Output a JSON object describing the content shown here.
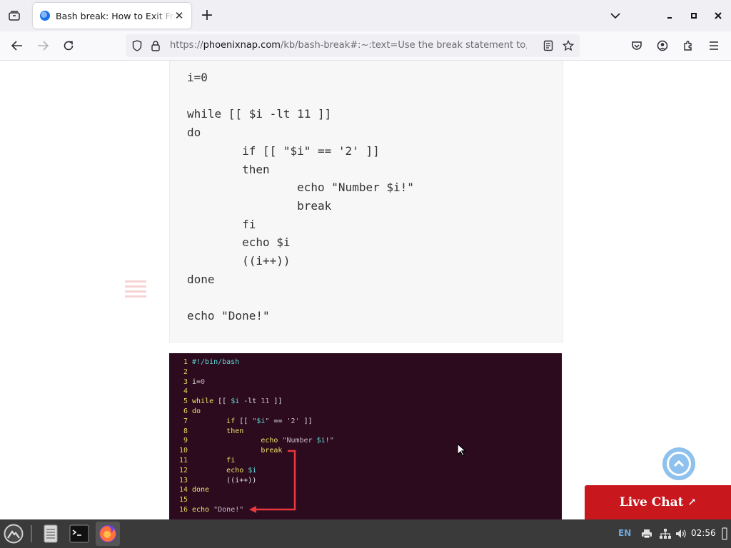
{
  "browser": {
    "tab_title": "Bash break: How to Exit From a Loop",
    "url_domain": "phoenixnap.com",
    "url_prefix": "https://",
    "url_rest": "/kb/bash-break#:~:text=Use the break statement to,) done"
  },
  "code_block": {
    "text": "i=0\n\nwhile [[ $i -lt 11 ]]\ndo\n        if [[ \"$i\" == '2' ]]\n        then\n                echo \"Number $i!\"\n                break\n        fi\n        echo $i\n        ((i++))\ndone\n\necho \"Done!\""
  },
  "terminal": {
    "lines": [
      {
        "n": "1",
        "code": "#!/bin/bash"
      },
      {
        "n": "2",
        "code": ""
      },
      {
        "n": "3",
        "code": "i=0"
      },
      {
        "n": "4",
        "code": ""
      },
      {
        "n": "5",
        "code": "while [[ $i -lt 11 ]]"
      },
      {
        "n": "6",
        "code": "do"
      },
      {
        "n": "7",
        "code": "        if [[ \"$i\" == '2' ]]"
      },
      {
        "n": "8",
        "code": "        then"
      },
      {
        "n": "9",
        "code": "                echo \"Number $i!\""
      },
      {
        "n": "10",
        "code": "                break"
      },
      {
        "n": "11",
        "code": "        fi"
      },
      {
        "n": "12",
        "code": "        echo $i"
      },
      {
        "n": "13",
        "code": "        ((i++))"
      },
      {
        "n": "14",
        "code": "done"
      },
      {
        "n": "15",
        "code": ""
      },
      {
        "n": "16",
        "code": "echo \"Done!\""
      }
    ]
  },
  "live_chat": {
    "label": "Live Chat",
    "arrow": "↗"
  },
  "taskbar": {
    "lang": "EN",
    "clock": "02:56"
  },
  "colors": {
    "live_chat_bg": "#c8171d",
    "terminal_bg": "#2c0b1e",
    "arrow_red": "#e8383d"
  }
}
